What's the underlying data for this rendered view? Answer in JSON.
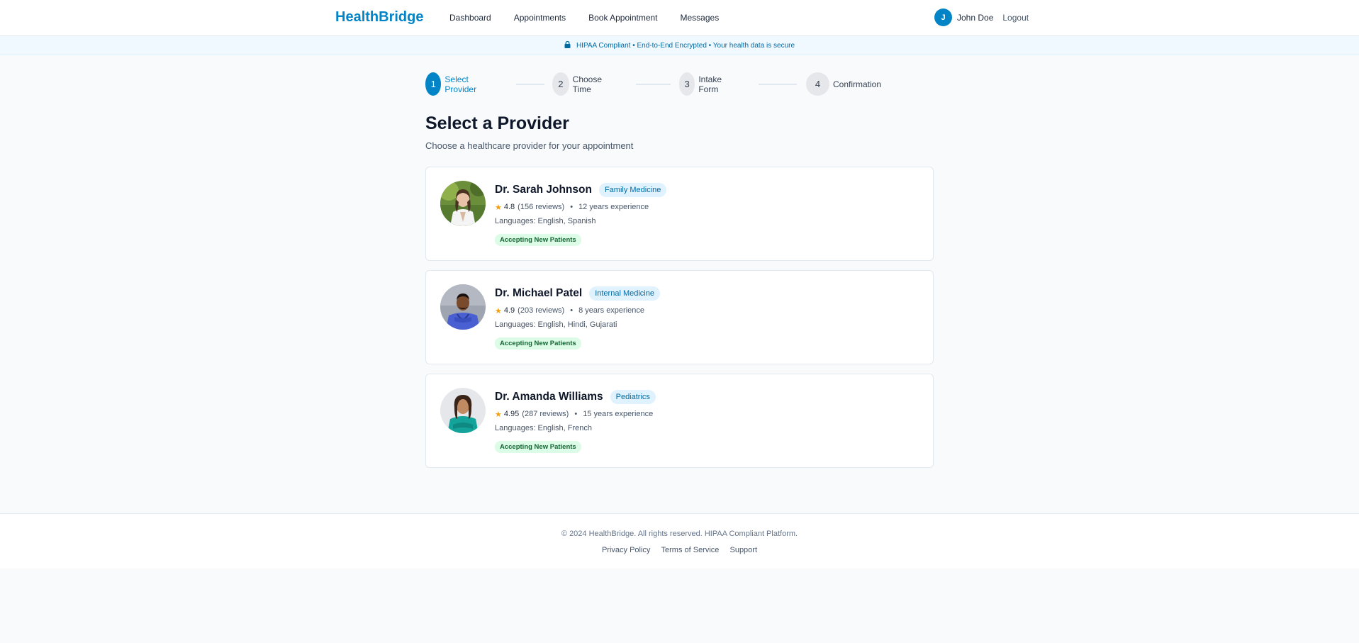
{
  "header": {
    "logo": "HealthBridge",
    "nav": [
      "Dashboard",
      "Appointments",
      "Book Appointment",
      "Messages"
    ],
    "user_initial": "J",
    "user_name": "John Doe",
    "logout": "Logout"
  },
  "banner": {
    "text": "HIPAA Compliant • End-to-End Encrypted • Your health data is secure"
  },
  "stepper": [
    {
      "number": "1",
      "label": "Select Provider",
      "active": true
    },
    {
      "number": "2",
      "label": "Choose Time",
      "active": false
    },
    {
      "number": "3",
      "label": "Intake Form",
      "active": false
    },
    {
      "number": "4",
      "label": "Confirmation",
      "active": false
    }
  ],
  "page": {
    "title": "Select a Provider",
    "subtitle": "Choose a healthcare provider for your appointment"
  },
  "providers": [
    {
      "name": "Dr. Sarah Johnson",
      "specialty": "Family Medicine",
      "rating": "4.8",
      "reviews": "(156 reviews)",
      "experience": "12 years experience",
      "languages": "Languages: English, Spanish",
      "status": "Accepting New Patients"
    },
    {
      "name": "Dr. Michael Patel",
      "specialty": "Internal Medicine",
      "rating": "4.9",
      "reviews": "(203 reviews)",
      "experience": "8 years experience",
      "languages": "Languages: English, Hindi, Gujarati",
      "status": "Accepting New Patients"
    },
    {
      "name": "Dr. Amanda Williams",
      "specialty": "Pediatrics",
      "rating": "4.95",
      "reviews": "(287 reviews)",
      "experience": "15 years experience",
      "languages": "Languages: English, French",
      "status": "Accepting New Patients"
    }
  ],
  "footer": {
    "copyright": "© 2024 HealthBridge. All rights reserved. HIPAA Compliant Platform.",
    "links": [
      "Privacy Policy",
      "Terms of Service",
      "Support"
    ]
  },
  "icons": {
    "lock": "lock-icon",
    "star": "star-icon"
  },
  "colors": {
    "brand": "#0284c7",
    "badge_bg": "#e0f2fe",
    "accepting_bg": "#dcfce7",
    "accepting_text": "#166534",
    "star": "#f59e0b"
  }
}
